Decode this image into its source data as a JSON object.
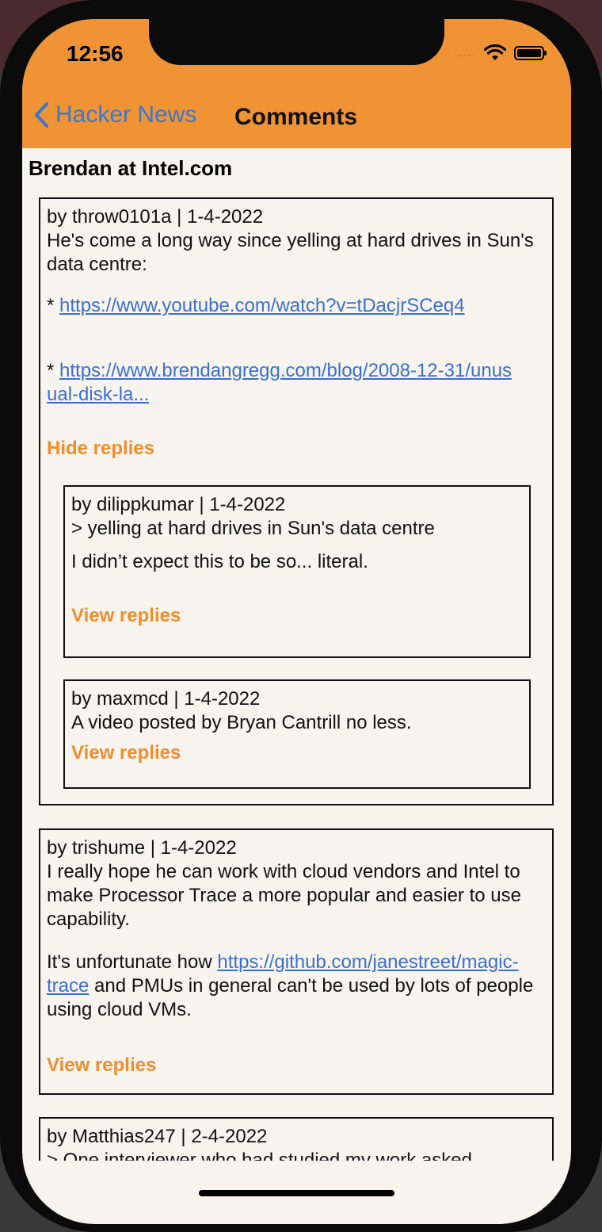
{
  "status_bar": {
    "time": "12:56",
    "signal": "....."
  },
  "nav": {
    "back_label": "Hacker News",
    "title": "Comments"
  },
  "story": {
    "title": "Brendan at Intel.com"
  },
  "comments": [
    {
      "meta": "by throw0101a | 1-4-2022",
      "line1": "He's come a long way since yelling at hard drives in Sun's data centre:",
      "bullet1_prefix": "* ",
      "bullet1_link": "https://www.youtube.com/watch?v=tDacjrSCeq4",
      "bullet2_prefix": "* ",
      "bullet2_link": "https://www.brendangregg.com/blog/2008-12-31/unusual-disk-la...",
      "action": "Hide replies",
      "replies": [
        {
          "meta": "by dilippkumar | 1-4-2022",
          "line1": "> yelling at hard drives in Sun's data centre",
          "line2": "I didn’t expect this to be so... literal.",
          "action": "View replies"
        },
        {
          "meta": "by maxmcd | 1-4-2022",
          "line1": "A video posted by Bryan Cantrill no less.",
          "action": "View replies"
        }
      ]
    },
    {
      "meta": "by trishume | 1-4-2022",
      "line1": "I really hope he can work with cloud vendors and Intel to make Processor Trace a more popular and easier to use capability.",
      "line2_prefix": "It's unfortunate how ",
      "line2_link": "https://github.com/janestreet/magic-trace",
      "line2_suffix": " and PMUs in general can't be used by lots of people using cloud VMs.",
      "action": "View replies"
    },
    {
      "meta": "by Matthias247 | 2-4-2022",
      "line1": "> One interviewer who had studied my work asked"
    }
  ]
}
